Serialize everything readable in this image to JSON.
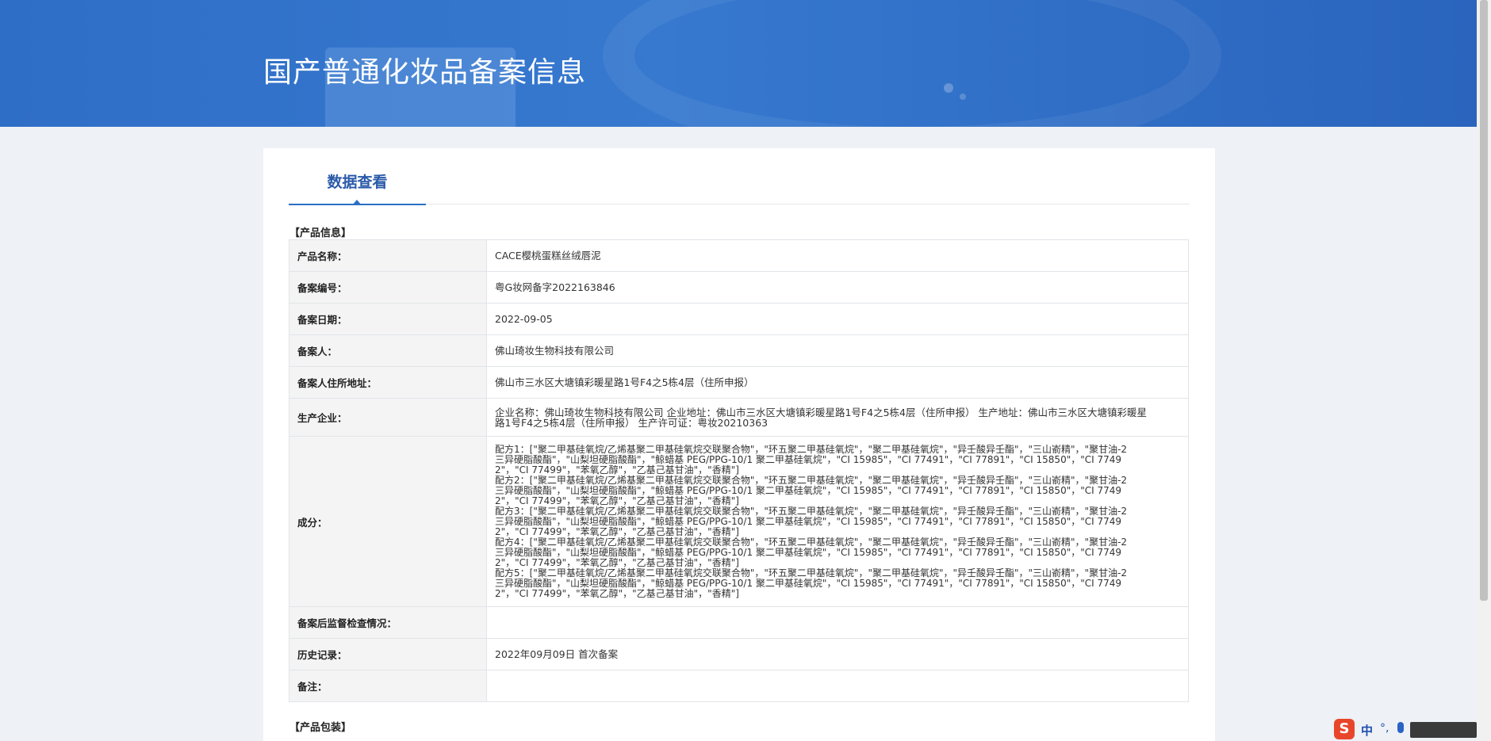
{
  "page": {
    "title": "国产普通化妆品备案信息",
    "tab": "数据查看"
  },
  "sections": {
    "product_info": "【产品信息】",
    "product_packaging": "【产品包装】"
  },
  "rows": [
    {
      "label": "产品名称：",
      "value": "CACE樱桃蛋糕丝绒唇泥"
    },
    {
      "label": "备案编号：",
      "value": "粤G妆网备字2022163846"
    },
    {
      "label": "备案日期：",
      "value": "2022-09-05"
    },
    {
      "label": "备案人：",
      "value": "佛山琦妆生物科技有限公司"
    },
    {
      "label": "备案人住所地址：",
      "value": "佛山市三水区大塘镇彩暖星路1号F4之5栋4层（住所申报）"
    },
    {
      "label": "生产企业：",
      "value": "企业名称：佛山琦妆生物科技有限公司 企业地址：佛山市三水区大塘镇彩暖星路1号F4之5栋4层（住所申报） 生产地址：佛山市三水区大塘镇彩暖星路1号F4之5栋4层（住所申报） 生产许可证：粤妆20210363"
    },
    {
      "label": "成分：",
      "value": ""
    },
    {
      "label": "备案后监督检查情况：",
      "value": ""
    },
    {
      "label": "历史记录：",
      "value": "2022年09月09日 首次备案"
    },
    {
      "label": "备注：",
      "value": ""
    }
  ],
  "ingredients": [
    "配方1：[\"聚二甲基硅氧烷/乙烯基聚二甲基硅氧烷交联聚合物\"，\"环五聚二甲基硅氧烷\"，\"聚二甲基硅氧烷\"，\"异壬酸异壬酯\"，\"三山嵛精\"，\"聚甘油-2 三异硬脂酸酯\"，\"山梨坦硬脂酸酯\"，\"鲸蜡基 PEG/PPG-10/1 聚二甲基硅氧烷\"，\"CI 15985\"，\"CI 77491\"，\"CI 77891\"，\"CI 15850\"，\"CI 77492\"，\"CI 77499\"，\"苯氧乙醇\"，\"乙基己基甘油\"，\"香精\"]",
    "配方2：[\"聚二甲基硅氧烷/乙烯基聚二甲基硅氧烷交联聚合物\"，\"环五聚二甲基硅氧烷\"，\"聚二甲基硅氧烷\"，\"异壬酸异壬酯\"，\"三山嵛精\"，\"聚甘油-2 三异硬脂酸酯\"，\"山梨坦硬脂酸酯\"，\"鲸蜡基 PEG/PPG-10/1 聚二甲基硅氧烷\"，\"CI 15985\"，\"CI 77491\"，\"CI 77891\"，\"CI 15850\"，\"CI 77492\"，\"CI 77499\"，\"苯氧乙醇\"，\"乙基己基甘油\"，\"香精\"]",
    "配方3：[\"聚二甲基硅氧烷/乙烯基聚二甲基硅氧烷交联聚合物\"，\"环五聚二甲基硅氧烷\"，\"聚二甲基硅氧烷\"，\"异壬酸异壬酯\"，\"三山嵛精\"，\"聚甘油-2 三异硬脂酸酯\"，\"山梨坦硬脂酸酯\"，\"鲸蜡基 PEG/PPG-10/1 聚二甲基硅氧烷\"，\"CI 15985\"，\"CI 77491\"，\"CI 77891\"，\"CI 15850\"，\"CI 77492\"，\"CI 77499\"，\"苯氧乙醇\"，\"乙基己基甘油\"，\"香精\"]",
    "配方4：[\"聚二甲基硅氧烷/乙烯基聚二甲基硅氧烷交联聚合物\"，\"环五聚二甲基硅氧烷\"，\"聚二甲基硅氧烷\"，\"异壬酸异壬酯\"，\"三山嵛精\"，\"聚甘油-2 三异硬脂酸酯\"，\"山梨坦硬脂酸酯\"，\"鲸蜡基 PEG/PPG-10/1 聚二甲基硅氧烷\"，\"CI 15985\"，\"CI 77491\"，\"CI 77891\"，\"CI 15850\"，\"CI 77492\"，\"CI 77499\"，\"苯氧乙醇\"，\"乙基己基甘油\"，\"香精\"]",
    "配方5：[\"聚二甲基硅氧烷/乙烯基聚二甲基硅氧烷交联聚合物\"，\"环五聚二甲基硅氧烷\"，\"聚二甲基硅氧烷\"，\"异壬酸异壬酯\"，\"三山嵛精\"，\"聚甘油-2 三异硬脂酸酯\"，\"山梨坦硬脂酸酯\"，\"鲸蜡基 PEG/PPG-10/1 聚二甲基硅氧烷\"，\"CI 15985\"，\"CI 77491\"，\"CI 77891\"，\"CI 15850\"，\"CI 77492\"，\"CI 77499\"，\"苯氧乙醇\"，\"乙基己基甘油\"，\"香精\"]"
  ],
  "tray": {
    "ime_logo": "S",
    "ime_lang": "中",
    "ime_punct": "°,"
  }
}
